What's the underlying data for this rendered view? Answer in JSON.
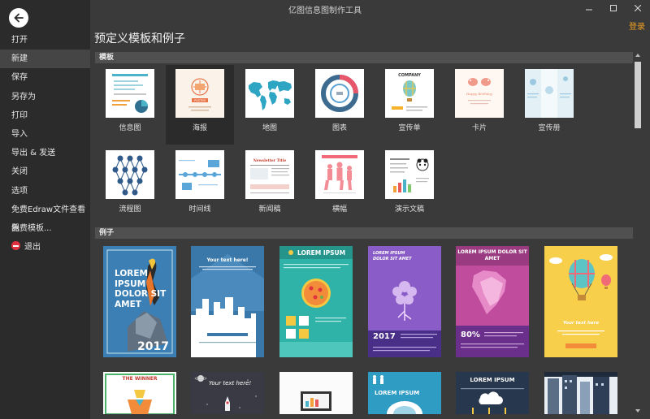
{
  "app": {
    "title": "亿图信息图制作工具",
    "login": "登录"
  },
  "sidebar": {
    "items": [
      {
        "label": "打开"
      },
      {
        "label": "新建"
      },
      {
        "label": "保存"
      },
      {
        "label": "另存为"
      },
      {
        "label": "打印"
      },
      {
        "label": "导入"
      },
      {
        "label": "导出 & 发送"
      },
      {
        "label": "关闭"
      },
      {
        "label": "选项"
      },
      {
        "label": "免费Edraw文件查看器"
      },
      {
        "label": "免费模板..."
      },
      {
        "label": "退出"
      }
    ],
    "active_index": 1
  },
  "main": {
    "title": "预定义模板和例子",
    "templates_section": "模板",
    "examples_section": "例子",
    "templates": [
      {
        "label": "信息图",
        "icon": "infographic-icon"
      },
      {
        "label": "海报",
        "icon": "poster-icon"
      },
      {
        "label": "地图",
        "icon": "world-map-icon"
      },
      {
        "label": "图表",
        "icon": "chart-icon"
      },
      {
        "label": "宣传单",
        "icon": "flyer-icon"
      },
      {
        "label": "卡片",
        "icon": "card-icon"
      },
      {
        "label": "宣传册",
        "icon": "brochure-icon"
      },
      {
        "label": "流程图",
        "icon": "flowchart-icon"
      },
      {
        "label": "时间线",
        "icon": "timeline-icon"
      },
      {
        "label": "新闻稿",
        "icon": "newsletter-icon"
      },
      {
        "label": "横幅",
        "icon": "banner-icon"
      },
      {
        "label": "演示文稿",
        "icon": "presentation-icon"
      }
    ],
    "thumb_text": {
      "poster_badge": "POSTER",
      "flyer_company": "COMPANY",
      "card_text": "Happy Birthday",
      "news_title": "Newsletter Title"
    },
    "examples": {
      "row1": [
        {
          "headline": "LOREM IPSUM DOLOR SIT AMET",
          "year": "2017"
        },
        {
          "headline": "Your text here!"
        },
        {
          "headline": "LOREM IPSUM"
        },
        {
          "headline": "LOREM IPSUM DOLOR SIT AMET",
          "year": "2017"
        },
        {
          "headline": "LOREM IPSUM DOLOR SIT AMET",
          "percent": "80%"
        },
        {
          "headline": "Your text here"
        }
      ],
      "row2": [
        {
          "headline": "THE WINNER"
        },
        {
          "headline": "Your text here!"
        },
        {
          "headline": ""
        },
        {
          "headline": "LOREM IPSUM"
        },
        {
          "headline": "LOREM IPSUM"
        },
        {
          "headline": ""
        }
      ]
    }
  }
}
